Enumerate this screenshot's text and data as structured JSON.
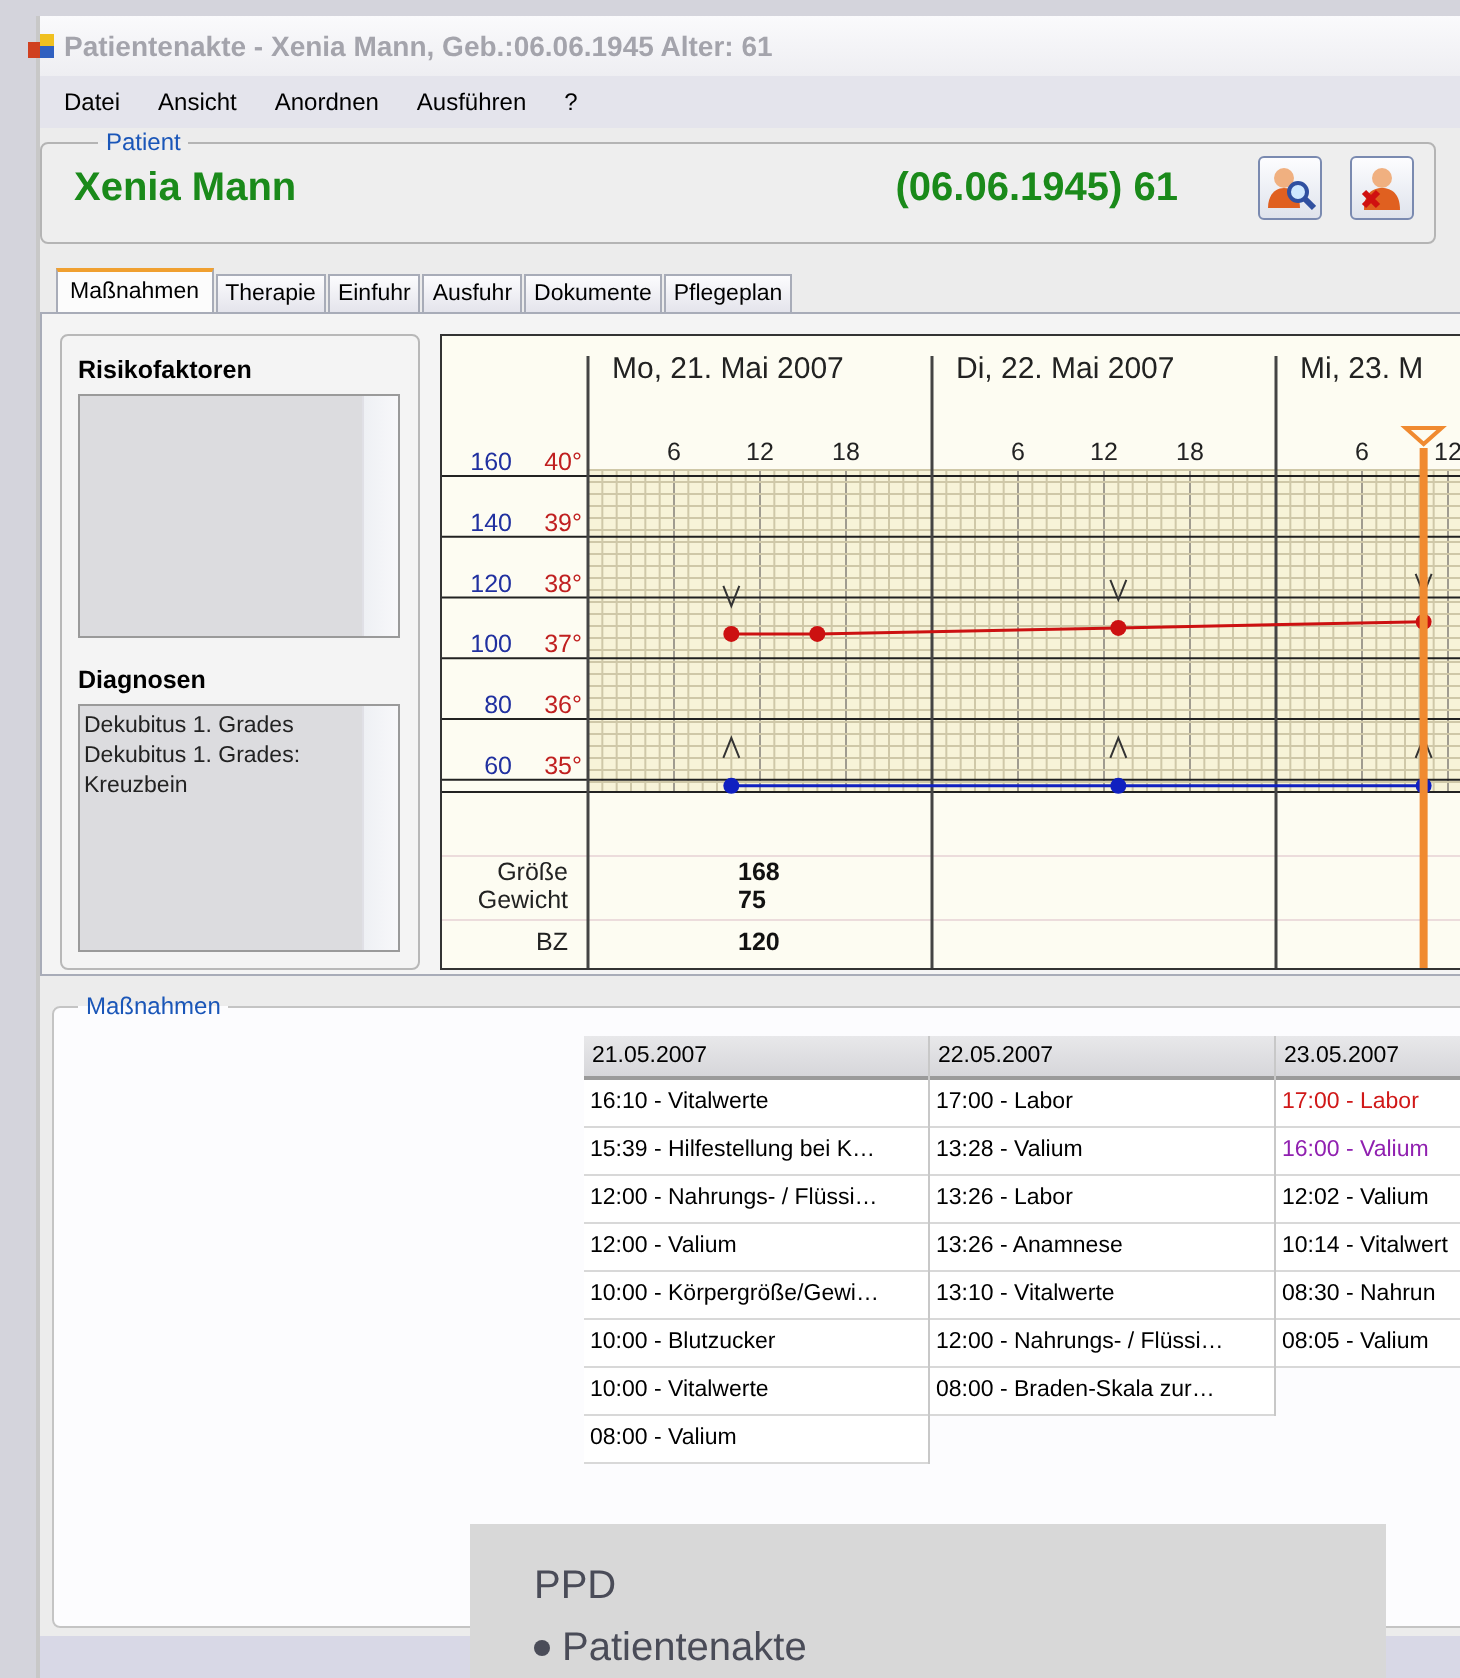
{
  "window": {
    "title": "Patientenakte - Xenia Mann, Geb.:06.06.1945 Alter: 61"
  },
  "menu": [
    "Datei",
    "Ansicht",
    "Anordnen",
    "Ausführen",
    "?"
  ],
  "patient": {
    "group_label": "Patient",
    "name": "Xenia Mann",
    "birth_age": "(06.06.1945) 61"
  },
  "tabs": [
    {
      "label": "Maßnahmen",
      "selected": true
    },
    {
      "label": "Therapie",
      "selected": false
    },
    {
      "label": "Einfuhr",
      "selected": false
    },
    {
      "label": "Ausfuhr",
      "selected": false
    },
    {
      "label": "Dokumente",
      "selected": false
    },
    {
      "label": "Pflegeplan",
      "selected": false
    }
  ],
  "risk_factors": {
    "title": "Risikofaktoren"
  },
  "diagnoses": {
    "title": "Diagnosen",
    "items": [
      "Dekubitus 1. Grades",
      "Dekubitus 1. Grades: Kreuzbein"
    ]
  },
  "vitals": {
    "days": [
      "Mo, 21. Mai 2007",
      "Di, 22. Mai 2007",
      "Mi, 23. M"
    ],
    "hour_ticks": [
      "6",
      "12",
      "18",
      "6",
      "12",
      "18",
      "6",
      "12"
    ],
    "pulse_ticks": [
      "160",
      "140",
      "120",
      "100",
      "80",
      "60"
    ],
    "temperature_ticks": [
      "40°",
      "39°",
      "38°",
      "37°",
      "36°",
      "35°"
    ],
    "measurements": [
      {
        "label": "Größe",
        "value": "168"
      },
      {
        "label": "Gewicht",
        "value": "75"
      },
      {
        "label": "BZ",
        "value": "120"
      }
    ]
  },
  "measures": {
    "group_label": "Maßnahmen",
    "columns": [
      {
        "date": "21.05.2007",
        "entries": [
          {
            "text": "16:10 - Vitalwerte",
            "color": "#000000"
          },
          {
            "text": "15:39 - Hilfestellung bei K…",
            "color": "#000000"
          },
          {
            "text": "12:00 - Nahrungs- / Flüssi…",
            "color": "#000000"
          },
          {
            "text": "12:00 - Valium",
            "color": "#000000"
          },
          {
            "text": "10:00 - Körpergröße/Gewi…",
            "color": "#000000"
          },
          {
            "text": "10:00 - Blutzucker",
            "color": "#000000"
          },
          {
            "text": "10:00 - Vitalwerte",
            "color": "#000000"
          },
          {
            "text": "08:00 - Valium",
            "color": "#000000"
          }
        ]
      },
      {
        "date": "22.05.2007",
        "entries": [
          {
            "text": "17:00 - Labor",
            "color": "#000000"
          },
          {
            "text": "13:28 - Valium",
            "color": "#000000"
          },
          {
            "text": "13:26 - Labor",
            "color": "#000000"
          },
          {
            "text": "13:26 - Anamnese",
            "color": "#000000"
          },
          {
            "text": "13:10 - Vitalwerte",
            "color": "#000000"
          },
          {
            "text": "12:00 - Nahrungs- / Flüssi…",
            "color": "#000000"
          },
          {
            "text": "08:00 - Braden-Skala zur…",
            "color": "#000000"
          }
        ]
      },
      {
        "date": "23.05.2007",
        "entries": [
          {
            "text": "17:00 - Labor",
            "color": "#d01818"
          },
          {
            "text": "16:00 - Valium",
            "color": "#9020b0"
          },
          {
            "text": "12:02 - Valium",
            "color": "#000000"
          },
          {
            "text": "10:14 - Vitalwert",
            "color": "#000000"
          },
          {
            "text": "08:30 - Nahrun",
            "color": "#000000"
          },
          {
            "text": "08:05 - Valium",
            "color": "#000000"
          }
        ]
      }
    ]
  },
  "overlay": {
    "title": "PPD",
    "bullets": [
      "Patientenakte"
    ]
  }
}
